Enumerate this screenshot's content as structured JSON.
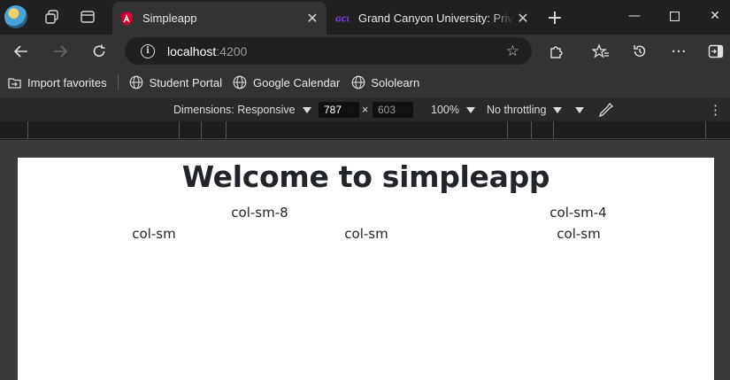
{
  "browser": {
    "tabs": [
      {
        "title": "Simpleapp",
        "active": true,
        "favicon": "angular-icon"
      },
      {
        "title": "Grand Canyon University: Private Christian University",
        "active": false,
        "favicon": "gcu-icon"
      }
    ],
    "address": {
      "host": "localhost",
      "port": ":4200"
    },
    "bookmarks": [
      {
        "label": "Import favorites",
        "icon": "import-icon"
      },
      {
        "label": "Student Portal",
        "icon": "globe-icon"
      },
      {
        "label": "Google Calendar",
        "icon": "globe-icon"
      },
      {
        "label": "Sololearn",
        "icon": "globe-icon"
      }
    ]
  },
  "devtools": {
    "dimensions_label": "Dimensions: Responsive",
    "width": "787",
    "times": "×",
    "height": "603",
    "zoom": "100%",
    "throttling": "No throttling"
  },
  "page": {
    "heading": "Welcome to simpleapp",
    "row1": [
      "col-sm-8",
      "col-sm-4"
    ],
    "row2": [
      "col-sm",
      "col-sm",
      "col-sm"
    ]
  },
  "colors": {
    "tab_active": "#333333",
    "frame": "#202020",
    "accent_angular": "#dd0031",
    "gcu_purple": "#522398"
  }
}
